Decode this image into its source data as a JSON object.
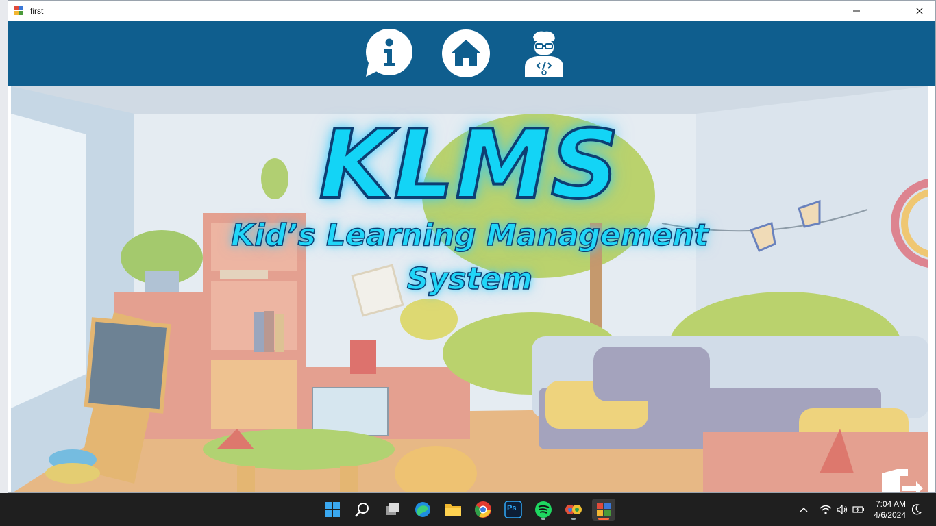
{
  "window": {
    "title": "first"
  },
  "nav": {
    "buttons": [
      {
        "name": "info-button",
        "icon": "info-speech-bubble-icon"
      },
      {
        "name": "home-button",
        "icon": "home-icon"
      },
      {
        "name": "developer-button",
        "icon": "developer-avatar-icon"
      }
    ]
  },
  "hero": {
    "title": "KLMS",
    "subtitle_line1": "Kid’s Learning Management",
    "subtitle_line2": "System",
    "exit_icon": "exit-door-icon"
  },
  "taskbar": {
    "apps": [
      "windows-start-icon",
      "search-icon",
      "task-view-icon",
      "edge-icon",
      "file-explorer-icon",
      "chrome-icon",
      "photoshop-icon",
      "spotify-icon",
      "app-icon",
      "active-app-icon"
    ],
    "photoshop_label": "Ps",
    "time": "7:04 AM",
    "date": "4/6/2024"
  },
  "colors": {
    "nav_blue": "#0f5e8e",
    "title_cyan": "#13d4f6",
    "title_outline": "#0d3f73",
    "taskbar_bg": "#1f1f1f"
  }
}
